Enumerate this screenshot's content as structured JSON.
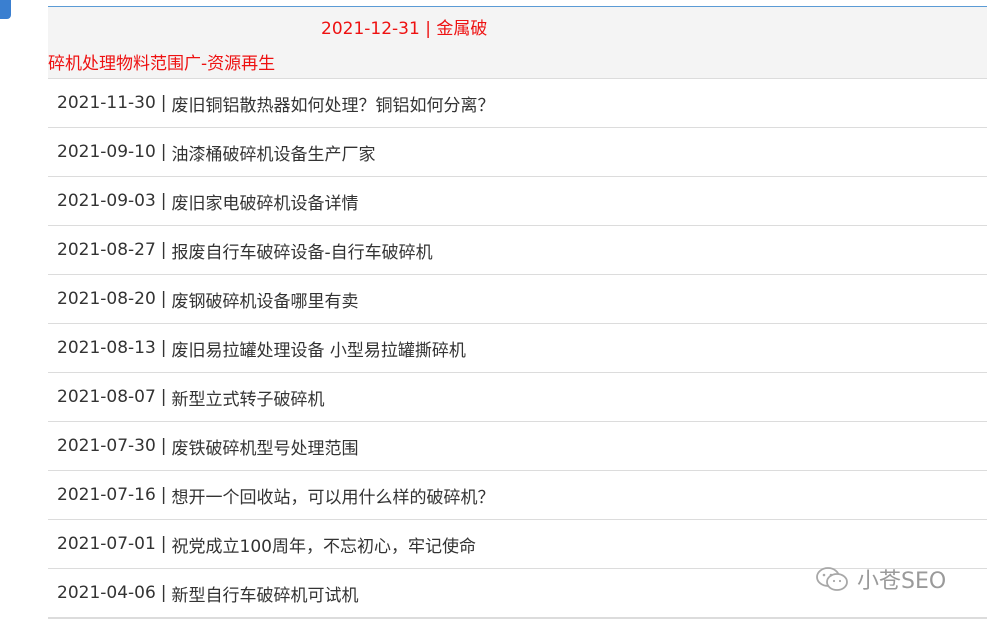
{
  "active_item": {
    "line1": "2021-12-31 | 金属破",
    "line2": "碎机处理物料范围广-资源再生"
  },
  "items": [
    {
      "date": "2021-11-30",
      "title": "废旧铜铝散热器如何处理？铜铝如何分离？"
    },
    {
      "date": "2021-09-10",
      "title": "油漆桶破碎机设备生产厂家"
    },
    {
      "date": "2021-09-03",
      "title": "废旧家电破碎机设备详情"
    },
    {
      "date": "2021-08-27",
      "title": "报废自行车破碎设备-自行车破碎机"
    },
    {
      "date": "2021-08-20",
      "title": "废钢破碎机设备哪里有卖"
    },
    {
      "date": "2021-08-13",
      "title": "废旧易拉罐处理设备 小型易拉罐撕碎机"
    },
    {
      "date": "2021-08-07",
      "title": "新型立式转子破碎机"
    },
    {
      "date": "2021-07-30",
      "title": "废铁破碎机型号处理范围"
    },
    {
      "date": "2021-07-16",
      "title": "想开一个回收站，可以用什么样的破碎机？"
    },
    {
      "date": "2021-07-01",
      "title": "祝党成立100周年，不忘初心，牢记使命"
    },
    {
      "date": "2021-04-06",
      "title": "新型自行车破碎机可试机"
    }
  ],
  "separator": "|",
  "watermark": {
    "icon": "wechat-icon",
    "text": "小苍SEO"
  }
}
